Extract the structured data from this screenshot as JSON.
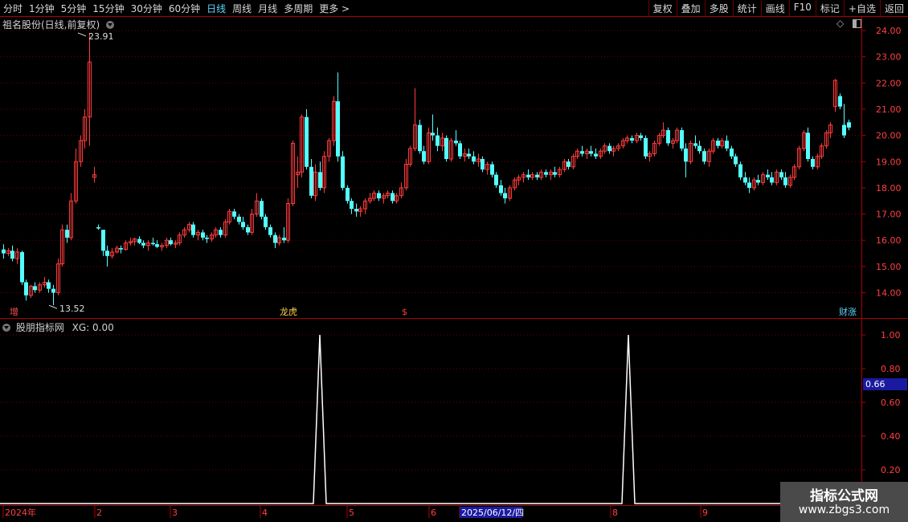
{
  "toolbar": {
    "periods": [
      "分时",
      "1分钟",
      "5分钟",
      "15分钟",
      "30分钟",
      "60分钟",
      "日线",
      "周线",
      "月线",
      "多周期",
      "更多 >"
    ],
    "active_period": "日线",
    "actions": [
      "复权",
      "叠加",
      "多股",
      "统计",
      "画线",
      "F10",
      "标记",
      "+自选",
      "返回"
    ]
  },
  "main_panel": {
    "title": "祖名股份(日线,前复权)"
  },
  "indicator_panel": {
    "title": "股朋指标网",
    "series_label": "XG: 0.00",
    "current_value_tag": "0.66"
  },
  "watermark": {
    "line1": "指标公式网",
    "line2": "www.zbgs3.com"
  },
  "colors": {
    "up": "#ff3b3b",
    "down": "#54ffff",
    "grid": "#6b0000",
    "axis": "#b00000",
    "line": "#ffffff",
    "date_highlight": "#1a1aa0"
  },
  "chart_data": [
    {
      "type": "candlestick",
      "title": "祖名股份(日线,前复权)",
      "ylim": [
        13.5,
        24.2
      ],
      "y_ticks": [
        "24.00",
        "23.00",
        "22.00",
        "21.00",
        "20.00",
        "19.00",
        "18.00",
        "17.00",
        "16.00",
        "15.00",
        "14.00"
      ],
      "grid": true,
      "annotations": [
        {
          "text": "23.91",
          "x": 97,
          "y": 23.91
        },
        {
          "text": "13.52",
          "x": 61,
          "y": 13.52
        }
      ],
      "event_tags": [
        {
          "text": "增",
          "x": 18,
          "color": "#ff5050"
        },
        {
          "text": "龙虎",
          "x": 354,
          "color": "#ffd54a"
        },
        {
          "text": "$",
          "x": 506,
          "color": "#ff3b3b"
        },
        {
          "text": "财涨",
          "x": 1050,
          "color": "#5fd6ff"
        }
      ],
      "ohlc": [
        [
          15.65,
          15.85,
          15.3,
          15.5
        ],
        [
          15.5,
          15.7,
          15.4,
          15.6
        ],
        [
          15.6,
          15.8,
          15.2,
          15.3
        ],
        [
          15.3,
          15.7,
          15.1,
          15.55
        ],
        [
          15.55,
          15.6,
          14.3,
          14.4
        ],
        [
          14.4,
          14.5,
          13.7,
          13.9
        ],
        [
          13.9,
          14.3,
          13.8,
          14.25
        ],
        [
          14.25,
          14.4,
          14.0,
          14.1
        ],
        [
          14.1,
          14.4,
          14.0,
          14.3
        ],
        [
          14.3,
          14.6,
          14.2,
          14.4
        ],
        [
          14.4,
          14.5,
          14.0,
          14.15
        ],
        [
          14.15,
          14.3,
          13.52,
          14.0
        ],
        [
          14.0,
          15.3,
          13.9,
          15.1
        ],
        [
          15.1,
          16.6,
          15.0,
          16.4
        ],
        [
          16.4,
          16.6,
          15.9,
          16.1
        ],
        [
          16.1,
          17.8,
          16.0,
          17.5
        ],
        [
          17.5,
          19.5,
          17.4,
          19.0
        ],
        [
          19.0,
          20.0,
          18.8,
          19.8
        ],
        [
          19.8,
          21.0,
          19.5,
          20.7
        ],
        [
          20.7,
          23.91,
          19.6,
          22.8
        ],
        [
          18.4,
          18.8,
          18.2,
          18.5
        ],
        [
          16.5,
          16.6,
          16.4,
          16.45
        ],
        [
          16.4,
          16.4,
          15.4,
          15.6
        ],
        [
          15.6,
          15.8,
          15.0,
          15.4
        ],
        [
          15.4,
          15.7,
          15.3,
          15.55
        ],
        [
          15.55,
          15.8,
          15.5,
          15.7
        ],
        [
          15.7,
          15.8,
          15.5,
          15.65
        ],
        [
          15.65,
          16.0,
          15.6,
          15.9
        ],
        [
          15.9,
          16.1,
          15.8,
          15.95
        ],
        [
          15.95,
          16.1,
          15.8,
          16.05
        ],
        [
          16.05,
          16.15,
          15.85,
          15.9
        ],
        [
          15.9,
          16.0,
          15.7,
          15.8
        ],
        [
          15.8,
          16.0,
          15.6,
          15.9
        ],
        [
          15.9,
          16.1,
          15.8,
          15.85
        ],
        [
          15.85,
          16.0,
          15.7,
          15.75
        ],
        [
          15.75,
          15.9,
          15.6,
          15.8
        ],
        [
          15.8,
          16.1,
          15.7,
          16.0
        ],
        [
          16.0,
          16.1,
          15.8,
          15.85
        ],
        [
          15.85,
          16.0,
          15.7,
          15.9
        ],
        [
          15.9,
          16.3,
          15.8,
          16.2
        ],
        [
          16.2,
          16.5,
          16.1,
          16.4
        ],
        [
          16.4,
          16.7,
          16.3,
          16.6
        ],
        [
          16.6,
          16.7,
          16.1,
          16.2
        ],
        [
          16.2,
          16.4,
          16.0,
          16.3
        ],
        [
          16.3,
          16.4,
          16.0,
          16.1
        ],
        [
          16.1,
          16.2,
          15.9,
          16.05
        ],
        [
          16.05,
          16.3,
          15.95,
          16.2
        ],
        [
          16.2,
          16.5,
          16.1,
          16.4
        ],
        [
          16.4,
          16.5,
          16.1,
          16.2
        ],
        [
          16.2,
          16.8,
          16.1,
          16.7
        ],
        [
          16.7,
          17.2,
          16.6,
          17.1
        ],
        [
          17.1,
          17.2,
          16.8,
          16.9
        ],
        [
          16.9,
          17.0,
          16.6,
          16.7
        ],
        [
          16.7,
          16.9,
          16.4,
          16.5
        ],
        [
          16.5,
          16.6,
          16.2,
          16.3
        ],
        [
          16.3,
          17.2,
          16.2,
          17.0
        ],
        [
          17.0,
          17.8,
          16.9,
          17.5
        ],
        [
          17.5,
          17.6,
          16.8,
          16.9
        ],
        [
          16.9,
          17.0,
          16.4,
          16.5
        ],
        [
          16.5,
          16.6,
          16.1,
          16.2
        ],
        [
          16.2,
          16.3,
          15.7,
          15.9
        ],
        [
          15.9,
          16.2,
          15.8,
          16.1
        ],
        [
          16.1,
          16.5,
          15.9,
          16.0
        ],
        [
          16.0,
          17.6,
          15.9,
          17.4
        ],
        [
          17.4,
          19.8,
          17.3,
          19.7
        ],
        [
          18.5,
          19.2,
          18.0,
          18.6
        ],
        [
          18.6,
          20.8,
          18.4,
          20.7
        ],
        [
          20.7,
          21.0,
          18.7,
          18.8
        ],
        [
          18.8,
          19.1,
          17.6,
          17.7
        ],
        [
          17.7,
          18.9,
          17.5,
          18.6
        ],
        [
          18.6,
          19.0,
          17.9,
          18.0
        ],
        [
          18.0,
          19.4,
          17.8,
          19.2
        ],
        [
          19.2,
          19.9,
          19.0,
          19.8
        ],
        [
          19.8,
          21.5,
          19.6,
          21.3
        ],
        [
          21.3,
          22.4,
          19.0,
          19.2
        ],
        [
          19.2,
          19.4,
          17.9,
          18.0
        ],
        [
          18.0,
          18.1,
          17.4,
          17.5
        ],
        [
          17.5,
          17.6,
          17.0,
          17.2
        ],
        [
          17.2,
          17.4,
          16.9,
          17.1
        ],
        [
          17.1,
          17.3,
          16.9,
          17.2
        ],
        [
          17.2,
          17.6,
          17.0,
          17.5
        ],
        [
          17.5,
          17.8,
          17.4,
          17.6
        ],
        [
          17.6,
          17.9,
          17.5,
          17.8
        ],
        [
          17.8,
          17.9,
          17.5,
          17.6
        ],
        [
          17.6,
          17.8,
          17.4,
          17.7
        ],
        [
          17.7,
          17.9,
          17.6,
          17.8
        ],
        [
          17.8,
          17.9,
          17.4,
          17.5
        ],
        [
          17.5,
          17.8,
          17.4,
          17.7
        ],
        [
          17.7,
          18.2,
          17.6,
          18.0
        ],
        [
          18.0,
          19.1,
          17.9,
          18.9
        ],
        [
          18.9,
          19.6,
          18.8,
          19.5
        ],
        [
          19.5,
          21.8,
          19.4,
          20.4
        ],
        [
          20.4,
          20.6,
          19.3,
          19.4
        ],
        [
          19.4,
          19.6,
          18.9,
          19.0
        ],
        [
          19.0,
          20.3,
          18.9,
          20.1
        ],
        [
          20.1,
          20.8,
          19.8,
          20.0
        ],
        [
          20.0,
          20.3,
          19.4,
          19.6
        ],
        [
          19.6,
          20.1,
          19.4,
          19.9
        ],
        [
          19.9,
          20.0,
          19.0,
          19.1
        ],
        [
          19.1,
          19.9,
          19.0,
          19.8
        ],
        [
          19.8,
          20.2,
          19.6,
          19.7
        ],
        [
          19.7,
          19.8,
          19.1,
          19.2
        ],
        [
          19.2,
          19.5,
          19.0,
          19.3
        ],
        [
          19.3,
          19.5,
          19.1,
          19.2
        ],
        [
          19.2,
          19.4,
          18.9,
          19.0
        ],
        [
          19.0,
          19.3,
          18.8,
          19.1
        ],
        [
          19.1,
          19.2,
          18.6,
          18.7
        ],
        [
          18.7,
          19.0,
          18.5,
          18.9
        ],
        [
          18.9,
          19.0,
          18.4,
          18.5
        ],
        [
          18.5,
          18.6,
          18.0,
          18.1
        ],
        [
          18.1,
          18.3,
          17.7,
          17.8
        ],
        [
          17.8,
          18.0,
          17.4,
          17.6
        ],
        [
          17.6,
          18.1,
          17.5,
          18.0
        ],
        [
          18.0,
          18.4,
          17.9,
          18.3
        ],
        [
          18.3,
          18.5,
          18.1,
          18.4
        ],
        [
          18.4,
          18.6,
          18.2,
          18.5
        ],
        [
          18.5,
          18.7,
          18.3,
          18.4
        ],
        [
          18.4,
          18.6,
          18.3,
          18.5
        ],
        [
          18.5,
          18.6,
          18.3,
          18.4
        ],
        [
          18.4,
          18.7,
          18.3,
          18.6
        ],
        [
          18.6,
          18.7,
          18.4,
          18.5
        ],
        [
          18.5,
          18.7,
          18.3,
          18.6
        ],
        [
          18.6,
          18.8,
          18.4,
          18.5
        ],
        [
          18.5,
          18.8,
          18.4,
          18.7
        ],
        [
          18.7,
          19.1,
          18.6,
          19.0
        ],
        [
          19.0,
          19.1,
          18.7,
          18.8
        ],
        [
          18.8,
          19.3,
          18.7,
          19.2
        ],
        [
          19.2,
          19.5,
          19.1,
          19.4
        ],
        [
          19.4,
          19.6,
          19.2,
          19.3
        ],
        [
          19.3,
          19.5,
          19.1,
          19.4
        ],
        [
          19.4,
          19.6,
          19.2,
          19.3
        ],
        [
          19.3,
          19.5,
          19.1,
          19.2
        ],
        [
          19.2,
          19.5,
          19.1,
          19.4
        ],
        [
          19.4,
          19.7,
          19.3,
          19.6
        ],
        [
          19.6,
          19.7,
          19.3,
          19.4
        ],
        [
          19.4,
          19.6,
          19.2,
          19.5
        ],
        [
          19.5,
          19.7,
          19.4,
          19.6
        ],
        [
          19.6,
          19.9,
          19.5,
          19.8
        ],
        [
          19.8,
          20.0,
          19.7,
          19.9
        ],
        [
          19.9,
          20.0,
          19.7,
          19.8
        ],
        [
          19.8,
          20.1,
          19.7,
          20.0
        ],
        [
          20.0,
          20.1,
          19.8,
          19.9
        ],
        [
          19.9,
          20.0,
          19.1,
          19.2
        ],
        [
          19.2,
          19.4,
          19.0,
          19.3
        ],
        [
          19.3,
          19.8,
          19.2,
          19.7
        ],
        [
          19.7,
          20.1,
          19.6,
          20.0
        ],
        [
          20.0,
          20.5,
          19.9,
          20.2
        ],
        [
          20.2,
          20.3,
          19.6,
          19.7
        ],
        [
          19.7,
          19.9,
          19.5,
          19.8
        ],
        [
          19.8,
          20.3,
          19.7,
          20.2
        ],
        [
          20.2,
          20.3,
          19.4,
          19.5
        ],
        [
          19.5,
          19.7,
          18.4,
          19.0
        ],
        [
          19.0,
          19.8,
          18.9,
          19.7
        ],
        [
          19.7,
          20.0,
          19.5,
          19.6
        ],
        [
          19.6,
          19.8,
          19.3,
          19.4
        ],
        [
          19.4,
          19.5,
          18.9,
          19.0
        ],
        [
          19.0,
          19.5,
          18.8,
          19.4
        ],
        [
          19.4,
          19.9,
          19.3,
          19.8
        ],
        [
          19.8,
          19.9,
          19.5,
          19.6
        ],
        [
          19.6,
          19.9,
          19.5,
          19.8
        ],
        [
          19.8,
          20.0,
          19.4,
          19.5
        ],
        [
          19.5,
          19.6,
          19.1,
          19.2
        ],
        [
          19.2,
          19.3,
          18.8,
          18.9
        ],
        [
          18.9,
          19.0,
          18.3,
          18.4
        ],
        [
          18.4,
          18.6,
          18.1,
          18.2
        ],
        [
          18.2,
          18.4,
          17.8,
          18.0
        ],
        [
          18.0,
          18.4,
          17.9,
          18.3
        ],
        [
          18.3,
          18.5,
          18.1,
          18.2
        ],
        [
          18.2,
          18.6,
          18.1,
          18.5
        ],
        [
          18.5,
          18.7,
          18.3,
          18.4
        ],
        [
          18.4,
          18.6,
          18.1,
          18.2
        ],
        [
          18.2,
          18.7,
          18.1,
          18.6
        ],
        [
          18.6,
          18.7,
          18.3,
          18.4
        ],
        [
          18.4,
          18.6,
          18.0,
          18.1
        ],
        [
          18.1,
          18.5,
          18.0,
          18.4
        ],
        [
          18.4,
          18.9,
          18.3,
          18.8
        ],
        [
          18.8,
          19.6,
          18.7,
          19.5
        ],
        [
          19.5,
          20.2,
          19.4,
          20.1
        ],
        [
          20.1,
          20.3,
          19.0,
          19.1
        ],
        [
          19.1,
          19.2,
          18.7,
          18.8
        ],
        [
          18.8,
          19.3,
          18.7,
          19.2
        ],
        [
          19.2,
          19.7,
          19.1,
          19.6
        ],
        [
          19.6,
          20.2,
          19.5,
          20.1
        ],
        [
          20.1,
          20.5,
          19.9,
          20.4
        ],
        [
          21.1,
          22.15,
          20.9,
          22.1
        ],
        [
          21.5,
          21.6,
          21.0,
          21.1
        ],
        [
          20.4,
          21.2,
          19.9,
          20.0
        ],
        [
          20.5,
          20.6,
          20.2,
          20.3
        ]
      ]
    },
    {
      "type": "line",
      "title": "股朋指标网",
      "series": [
        {
          "name": "XG",
          "peaks": [
            {
              "x": 398,
              "value": 1.0
            },
            {
              "x": 782,
              "value": 1.0
            }
          ]
        }
      ],
      "ylim": [
        0,
        1.05
      ],
      "y_ticks": [
        "1.00",
        "0.80",
        "0.60",
        "0.40",
        "0.20"
      ],
      "x_ticks": [
        "2024年",
        "2",
        "3",
        "4",
        "5",
        "6",
        "2025/06/12/四",
        "8",
        "9"
      ]
    }
  ]
}
